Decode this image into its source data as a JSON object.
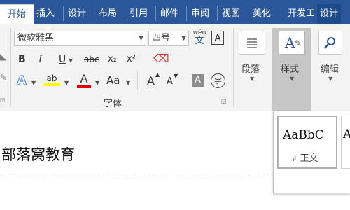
{
  "tabs": [
    "开始",
    "插入",
    "设计",
    "布局",
    "引用",
    "邮件",
    "审阅",
    "视图",
    "美化",
    "开发工",
    "设计"
  ],
  "font": {
    "name": "微软雅黑",
    "size": "四号",
    "phonetic_top": "wén",
    "phonetic_bottom": "文",
    "bordered_char": "A"
  },
  "buttons": {
    "bold": "B",
    "italic": "I",
    "underline": "U",
    "strike": "abc",
    "subscript": "x₂",
    "superscript": "x²",
    "text_effect": "A",
    "highlight": "ab",
    "font_color": "A",
    "change_case": "Aa",
    "grow_font": "A",
    "shrink_font": "A",
    "char_shading": "A",
    "enclose_char": "字"
  },
  "group_labels": {
    "font": "字体"
  },
  "large_buttons": {
    "paragraph": "段落",
    "styles": "样式",
    "editing": "编辑"
  },
  "styles_gallery": {
    "first_sample": "AaBbC",
    "first_name": "正文",
    "second_sample": "A"
  },
  "document": {
    "text": "部落窝教育"
  },
  "colors": {
    "accent": "#2b579a",
    "highlight": "#ffff00",
    "font_color": "#e00000"
  }
}
